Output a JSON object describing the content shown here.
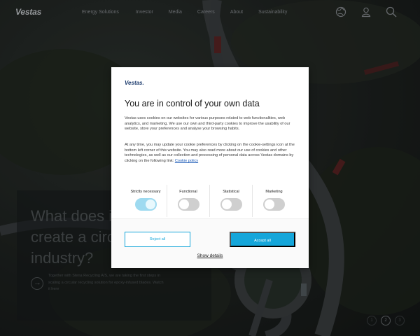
{
  "nav": {
    "logo": "Vestas",
    "items": [
      "Energy Solutions",
      "Investor",
      "Media",
      "Careers",
      "About",
      "Sustainability"
    ],
    "icons": [
      "globe-icon",
      "user-icon",
      "search-icon"
    ]
  },
  "hero": {
    "title": "What does it take to\ncreate a circular\nindustry?",
    "text": "Together with Stena Recycling A/S, we are taking the first steps in scaling a circular recycling solution for epoxy-infused blades. Watch it here"
  },
  "slider": {
    "items": [
      "1",
      "2",
      "3"
    ],
    "active": 1
  },
  "modal": {
    "logo": "Vestas.",
    "title": "You are in control of your own data",
    "paragraph1": "Vestas uses cookies on our websites for various purposes related to web functionalities, web analytics, and marketing. We use our own and third-party cookies to improve the usability of our website, store your preferences and analyse your browsing habits.",
    "paragraph2": "At any time, you may update your cookie preferences by clicking on the cookie-settings icon at the bottom left corner of this website. You may also read more about our use of cookies and other technologies, as well as our collection and processing of personal data across Vestas domains by clicking on the following link: ",
    "policy_link": "Cookie policy",
    "toggles": [
      {
        "label": "Strictly necessary",
        "on": true
      },
      {
        "label": "Functional",
        "on": false
      },
      {
        "label": "Statistical",
        "on": false
      },
      {
        "label": "Marketing",
        "on": false
      }
    ],
    "reject_label": "Reject all",
    "accept_label": "Accept all",
    "details_label": "Show details"
  },
  "colors": {
    "accent": "#15a6da",
    "logo": "#1d3c6e"
  }
}
